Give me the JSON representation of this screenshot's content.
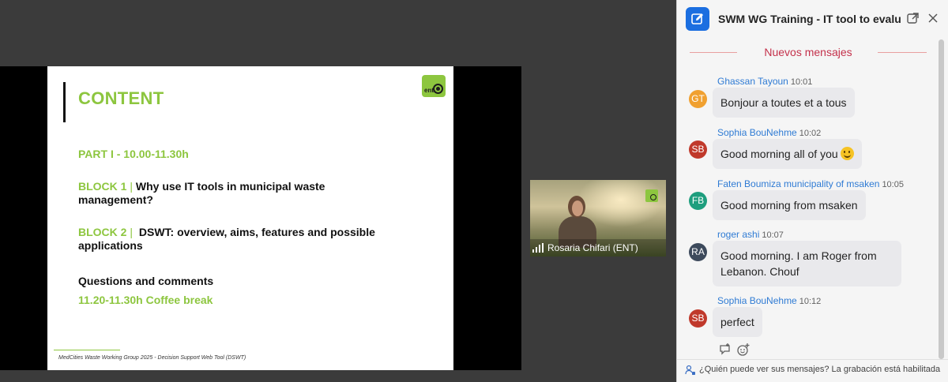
{
  "slide": {
    "title": "CONTENT",
    "logo_text": "ent",
    "part1": "PART I - 10.00-11.30h",
    "block1_label": "BLOCK 1",
    "block1_sep": "|",
    "block1_text_line1": "Why use IT tools in municipal waste",
    "block1_text_line2": "management?",
    "block2_label": "BLOCK 2",
    "block2_sep": "|",
    "block2_text_line1": "DSWT: overview, aims, features and possible",
    "block2_text_line2": "applications",
    "questions": "Questions and comments",
    "coffee": "11.20-11.30h Coffee break",
    "footer": "MedCities Waste Working Group 2025 - Decision Support Web Tool (DSWT)",
    "accent_color": "#8dc63f"
  },
  "participant": {
    "name": "Rosaria Chifari (ENT)",
    "icon": "signal-bars-icon"
  },
  "chat": {
    "title": "SWM WG Training - IT tool to evaluate",
    "new_messages": "Nuevos mensajes",
    "footer_text": "¿Quién puede ver sus mensajes? La grabación está habilitada",
    "accent_color": "#1b6ee0",
    "messages": [
      {
        "initials": "GT",
        "author": "Ghassan Tayoun",
        "time": "10:01",
        "text": "Bonjour a toutes et a tous",
        "avatar_color": "#f0a030"
      },
      {
        "initials": "SB",
        "author": "Sophia BouNehme",
        "time": "10:02",
        "text": "Good morning all of you",
        "avatar_color": "#c0392b"
      },
      {
        "initials": "FB",
        "author": "Faten Boumiza municipality of msaken",
        "time": "10:05",
        "text": "Good morning from msaken",
        "avatar_color": "#1e9e7e"
      },
      {
        "initials": "RA",
        "author": "roger ashi",
        "time": "10:07",
        "text_line1": "Good morning. I am Roger from",
        "text_line2": "Lebanon. Chouf",
        "avatar_color": "#3d4a5c"
      },
      {
        "initials": "SB",
        "author": "Sophia BouNehme",
        "time": "10:12",
        "text": "perfect",
        "avatar_color": "#c0392b"
      }
    ]
  }
}
